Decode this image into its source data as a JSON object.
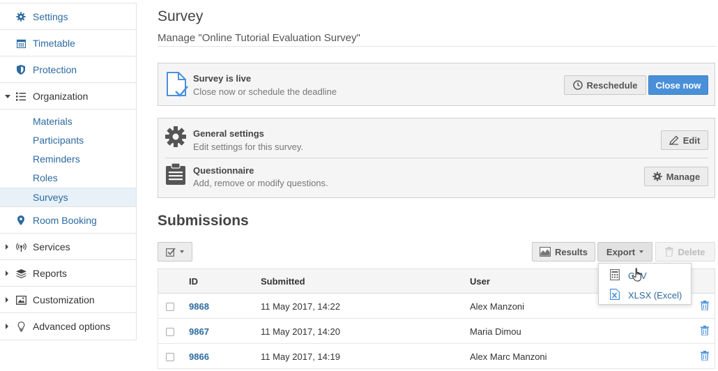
{
  "sidebar": {
    "items": [
      {
        "label": "Settings",
        "icon": "gear-icon"
      },
      {
        "label": "Timetable",
        "icon": "calendar-icon"
      },
      {
        "label": "Protection",
        "icon": "shield-icon"
      },
      {
        "label": "Organization",
        "icon": "list-icon"
      },
      {
        "label": "Room Booking",
        "icon": "map-pin-icon"
      },
      {
        "label": "Services",
        "icon": "broadcast-icon"
      },
      {
        "label": "Reports",
        "icon": "layers-icon"
      },
      {
        "label": "Customization",
        "icon": "image-icon"
      },
      {
        "label": "Advanced options",
        "icon": "lightbulb-icon"
      }
    ],
    "organization_children": [
      "Materials",
      "Participants",
      "Reminders",
      "Roles",
      "Surveys"
    ],
    "active_child": "Surveys"
  },
  "page": {
    "title": "Survey",
    "subtitle": "Manage \"Online Tutorial Evaluation Survey\""
  },
  "live_panel": {
    "title": "Survey is live",
    "description": "Close now or schedule the deadline",
    "reschedule_label": "Reschedule",
    "close_label": "Close now"
  },
  "settings_panel": {
    "general_title": "General settings",
    "general_desc": "Edit settings for this survey.",
    "edit_label": "Edit",
    "questionnaire_title": "Questionnaire",
    "questionnaire_desc": "Add, remove or modify questions.",
    "manage_label": "Manage"
  },
  "submissions": {
    "title": "Submissions",
    "results_label": "Results",
    "export_label": "Export",
    "delete_label": "Delete",
    "columns": [
      "ID",
      "Submitted",
      "User"
    ],
    "rows": [
      {
        "id": "9868",
        "submitted": "11 May 2017, 14:22",
        "user": "Alex Manzoni"
      },
      {
        "id": "9867",
        "submitted": "11 May 2017, 14:20",
        "user": "Maria Dimou"
      },
      {
        "id": "9866",
        "submitted": "11 May 2017, 14:19",
        "user": "Alex Marc Manzoni"
      }
    ]
  },
  "export_menu": {
    "csv_label": "CSV",
    "xlsx_label": "XLSX (Excel)"
  },
  "colors": {
    "link": "#2c6aa0",
    "primary": "#4a90d9",
    "active_bg": "#e8f0f8"
  }
}
